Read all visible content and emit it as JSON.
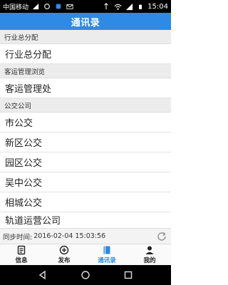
{
  "status_bar": {
    "carrier": "中国移动",
    "time": "15:04"
  },
  "header": {
    "title": "通讯录"
  },
  "contacts": {
    "sections": [
      {
        "header": "行业总分配",
        "items": [
          "行业总分配"
        ]
      },
      {
        "header": "客运管理浏览",
        "items": [
          "客运管理处"
        ]
      },
      {
        "header": "公交公司",
        "items": [
          "市公交",
          "新区公交",
          "园区公交",
          "吴中公交",
          "相城公交",
          "轨道运营公司"
        ]
      }
    ]
  },
  "sync": {
    "label": "同步时间:",
    "time": "2016-02-04 15:03:56"
  },
  "tabs": [
    {
      "label": "信息",
      "icon": "info-icon",
      "active": false
    },
    {
      "label": "发布",
      "icon": "plus-circle-icon",
      "active": false
    },
    {
      "label": "通讯录",
      "icon": "book-icon",
      "active": true
    },
    {
      "label": "我的",
      "icon": "person-icon",
      "active": false
    }
  ],
  "colors": {
    "accent": "#2f8ae5",
    "section_bg": "#ececec"
  }
}
